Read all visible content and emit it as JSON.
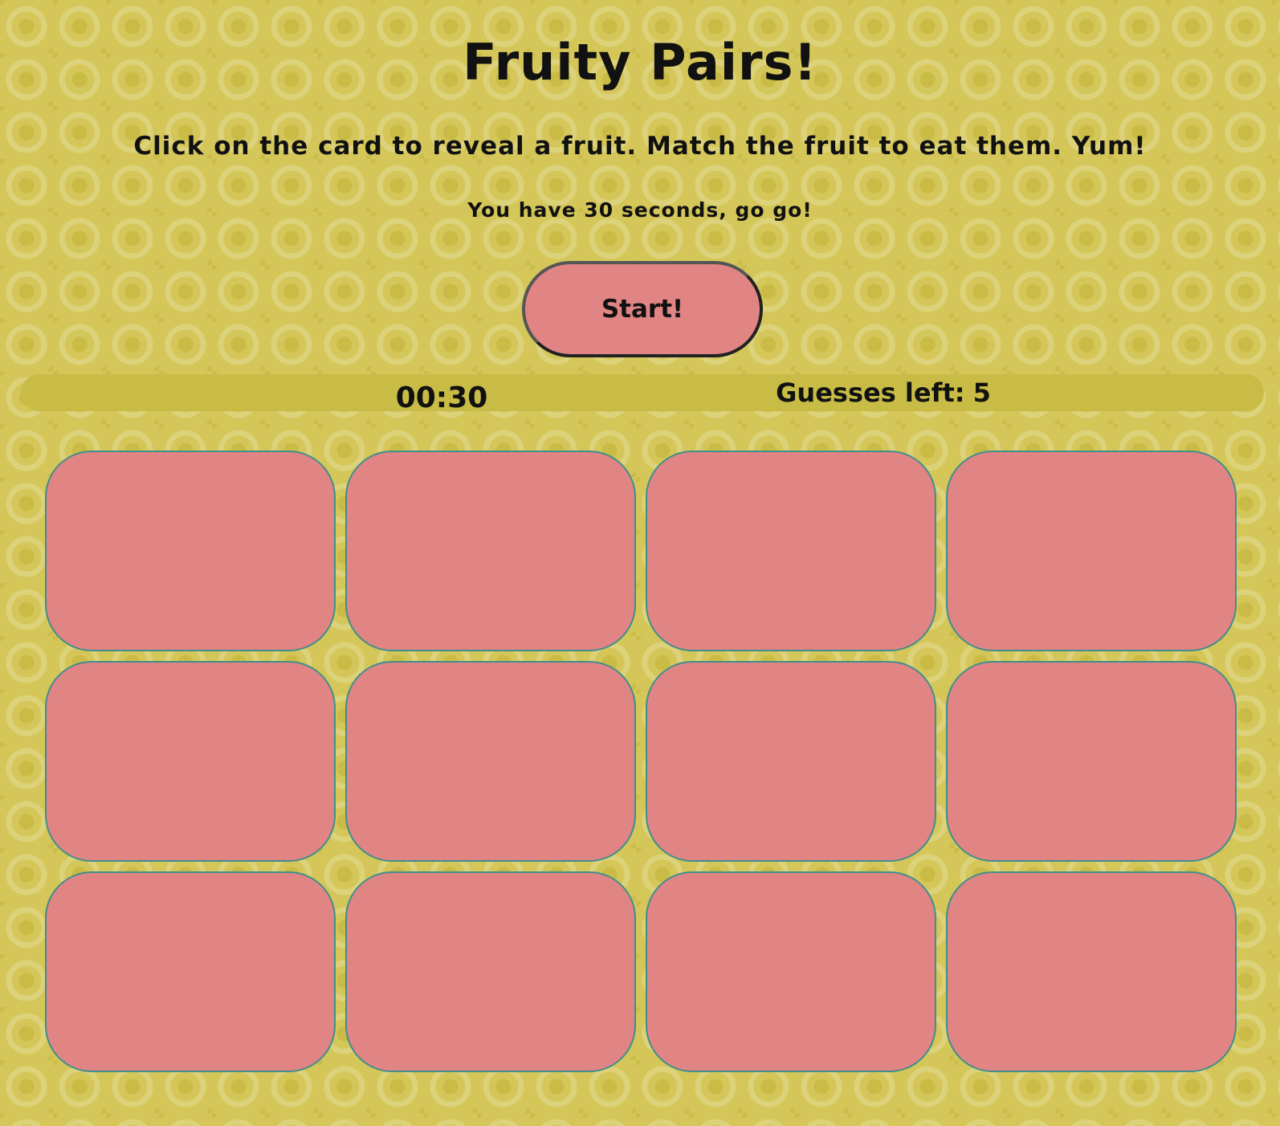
{
  "game": {
    "title": "Fruity Pairs!",
    "instructions": "Click on the card to reveal a fruit. Match the fruit to eat them. Yum!",
    "time_note": "You have 30 seconds, go go!",
    "start_label": "Start!"
  },
  "status": {
    "timer": "00:30",
    "guesses_label": "Guesses left:",
    "guesses_value": "5"
  },
  "board": {
    "card_count": 12,
    "face_down": true
  },
  "colors": {
    "background": "#d4c659",
    "card": "#e08484",
    "card_border": "#3f8f8c",
    "status_bar": "#c8bc46",
    "button": "#e08484"
  }
}
